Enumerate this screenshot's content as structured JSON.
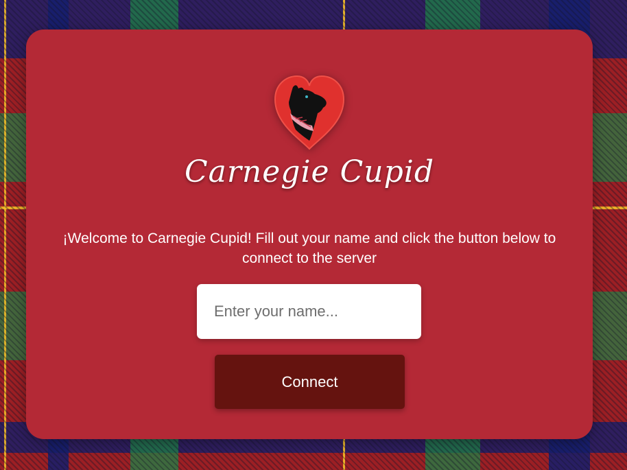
{
  "app": {
    "title": "Carnegie Cupid",
    "logo_icon": "scottie-dog-heart-icon"
  },
  "welcome": {
    "text": "¡Welcome to Carnegie Cupid! Fill out your name and click the button below to connect to the server"
  },
  "form": {
    "name_placeholder": "Enter your name...",
    "name_value": "",
    "connect_label": "Connect"
  },
  "colors": {
    "card": "#b42936",
    "button": "#65130f",
    "heart": "#e0312e",
    "background": "#9c1f24"
  }
}
